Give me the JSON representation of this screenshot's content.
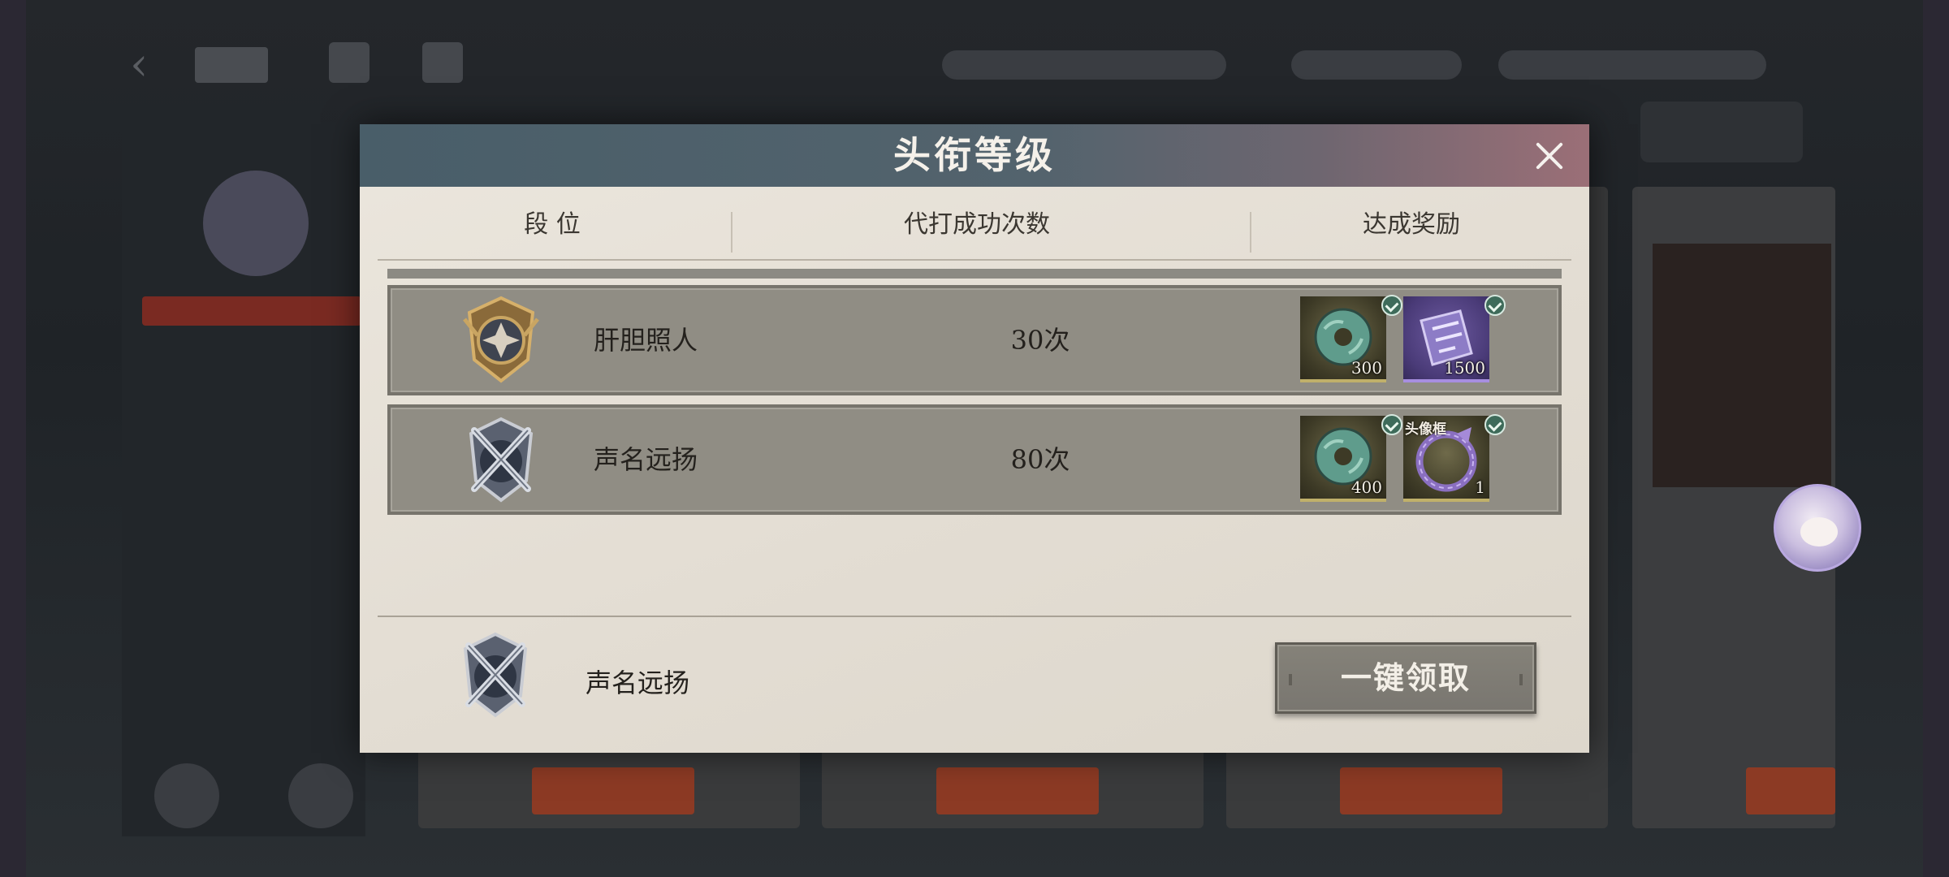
{
  "modal": {
    "title": "头衔等级",
    "columns": {
      "rank": "段 位",
      "count": "代打成功次数",
      "reward": "达成奖励"
    },
    "rows": [
      {
        "name": "肝胆照人",
        "count": "30次",
        "badge_icon": "bronze-shield-rank-icon",
        "rewards": [
          {
            "icon": "jade-token-icon",
            "qty": "300",
            "tag": "",
            "claimed": true
          },
          {
            "icon": "purple-ticket-icon",
            "qty": "1500",
            "tag": "",
            "claimed": true
          }
        ]
      },
      {
        "name": "声名远扬",
        "count": "80次",
        "badge_icon": "silver-crossed-swords-rank-icon",
        "rewards": [
          {
            "icon": "jade-token-icon",
            "qty": "400",
            "tag": "",
            "claimed": true
          },
          {
            "icon": "avatar-frame-icon",
            "qty": "1",
            "tag": "头像框",
            "claimed": true
          }
        ]
      }
    ],
    "current": {
      "name": "声名远扬",
      "badge_icon": "silver-crossed-swords-rank-icon"
    },
    "claim_all_label": "一键领取"
  },
  "colors": {
    "header_start": "#495e69",
    "header_end": "#9b6f77",
    "panel_bg": "#e6e0d7",
    "row_bg": "#908d84",
    "button_bg": "#7f7c75"
  }
}
